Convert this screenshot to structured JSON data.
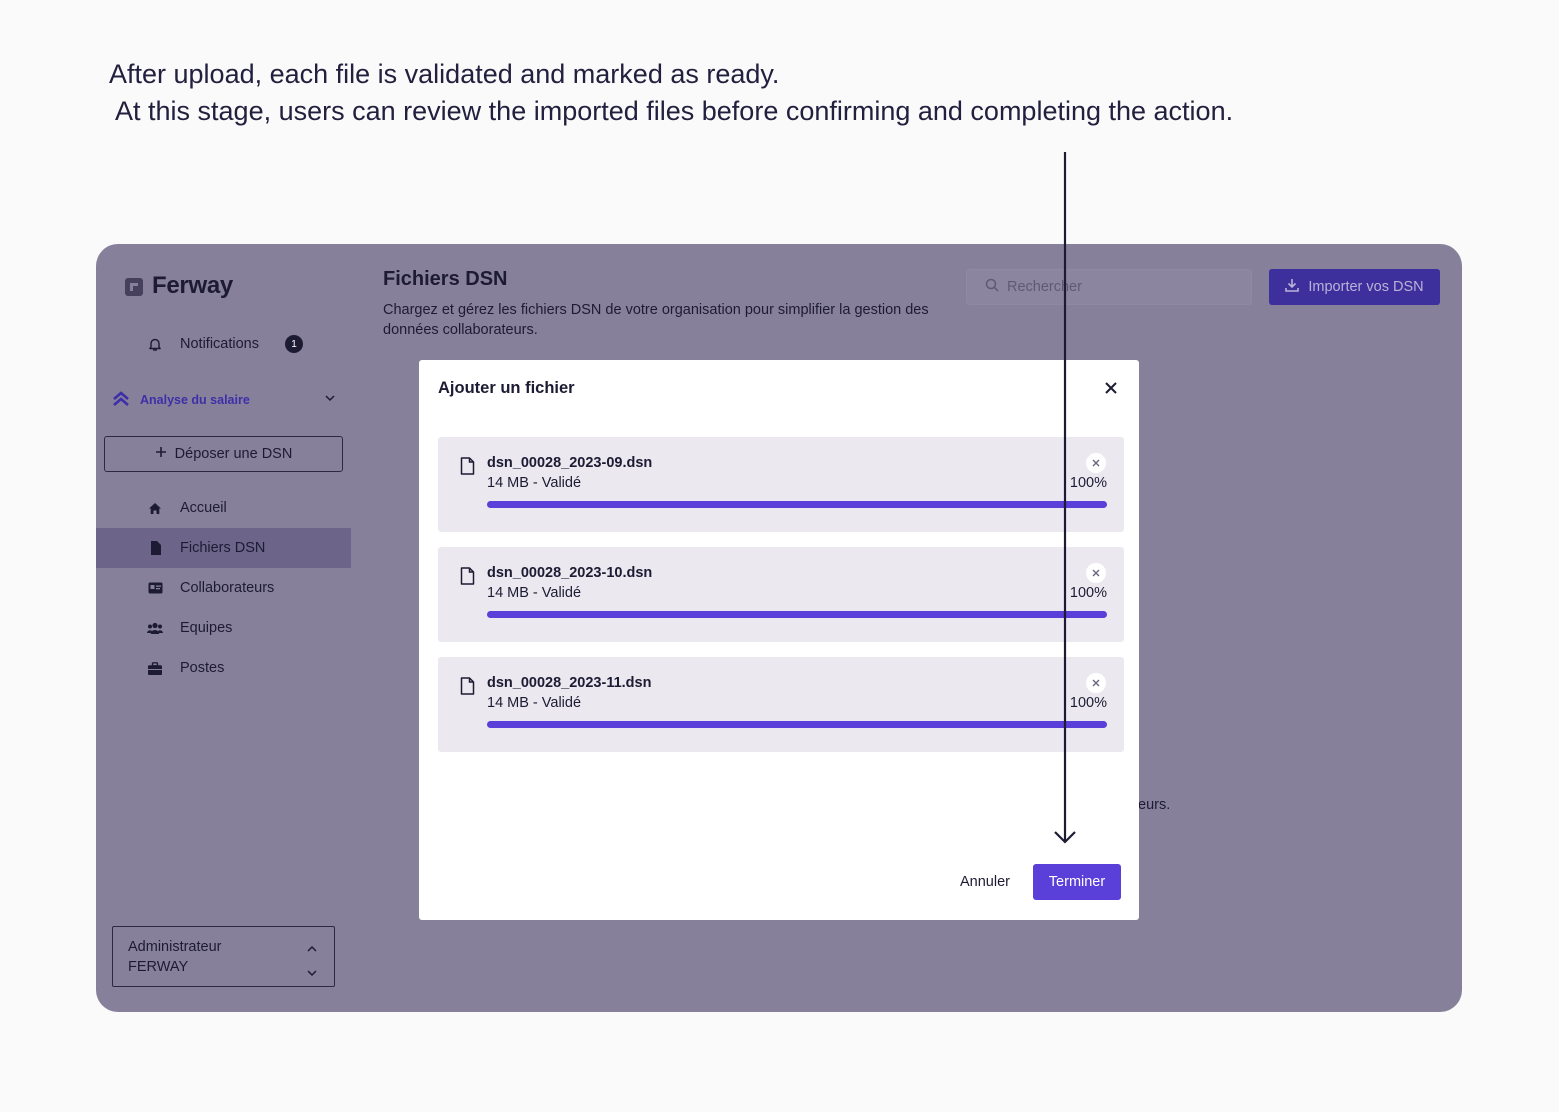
{
  "caption": {
    "line1": "After upload, each file is validated and marked as ready.",
    "line2": " At this stage, users can review the imported files before confirming and completing the action."
  },
  "colors": {
    "accent": "#5a3fd8",
    "overlay": "#87809a",
    "text": "#1d1b33"
  },
  "sidebar": {
    "logo_text": "Ferway",
    "notifications": {
      "label": "Notifications",
      "count": "1",
      "icon": "bell-icon"
    },
    "section": {
      "label": "Analyse du salaire",
      "icon": "chevrons-up-icon"
    },
    "deposit_button": "Déposer une DSN",
    "items": [
      {
        "label": "Accueil",
        "icon": "home-icon"
      },
      {
        "label": "Fichiers DSN",
        "icon": "file-icon",
        "active": true
      },
      {
        "label": "Collaborateurs",
        "icon": "id-card-icon"
      },
      {
        "label": "Equipes",
        "icon": "users-icon"
      },
      {
        "label": "Postes",
        "icon": "briefcase-icon"
      }
    ],
    "account": {
      "role": "Administrateur",
      "org": "FERWAY"
    }
  },
  "header": {
    "title": "Fichiers DSN",
    "description": "Chargez et gérez les fichiers DSN de votre organisation pour simplifier la gestion des données collaborateurs.",
    "search_placeholder": "Rechercher",
    "import_button": "Importer vos DSN"
  },
  "background_fragment": "eurs.",
  "modal": {
    "title": "Ajouter un fichier",
    "files": [
      {
        "name": "dsn_00028_2023-09.dsn",
        "meta": "14 MB - Validé",
        "percent_label": "100%",
        "progress": 1.0
      },
      {
        "name": "dsn_00028_2023-10.dsn",
        "meta": "14 MB - Validé",
        "percent_label": "100%",
        "progress": 1.0
      },
      {
        "name": "dsn_00028_2023-11.dsn",
        "meta": "14 MB - Validé",
        "percent_label": "100%",
        "progress": 1.0
      }
    ],
    "cancel_button": "Annuler",
    "finish_button": "Terminer"
  }
}
